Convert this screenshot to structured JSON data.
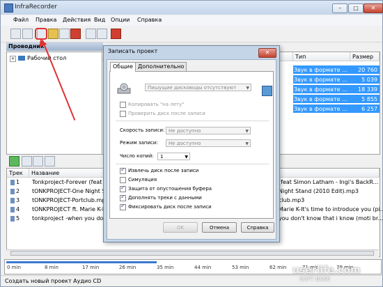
{
  "window": {
    "title": "InfraRecorder",
    "minimize": "–",
    "maximize": "□",
    "close": "✕"
  },
  "menu": [
    "Файл",
    "Правка",
    "Действия",
    "Вид",
    "Опции",
    "Справка"
  ],
  "explorer": {
    "title": "Проводник",
    "tree_item": "Рабочий стол"
  },
  "filelist": {
    "headers": {
      "type": "Тип",
      "size": "Размер"
    },
    "rows": [
      {
        "type": "Звук в формате ...",
        "size": "20 760"
      },
      {
        "type": "Звук в формате ...",
        "size": "5 039"
      },
      {
        "type": "Звук в формате ...",
        "size": "18 339"
      },
      {
        "type": "Звук в формате ...",
        "size": "5 855"
      },
      {
        "type": "Звук в формате ...",
        "size": "6 257"
      }
    ]
  },
  "tracks": {
    "headers": {
      "track": "Трек",
      "name": "Название"
    },
    "rows": [
      {
        "num": "1",
        "name": "Tonkproject-Forever (feat Sin",
        "right": "(feat Simon Latham - Ingi's BackR..."
      },
      {
        "num": "2",
        "name": "tONKPROJECT-One Night Sta",
        "right": "Night Stand (2010 Edit).mp3"
      },
      {
        "num": "3",
        "name": "tONKPROJECT-Portclub.mp3",
        "right": "club.mp3"
      },
      {
        "num": "4",
        "name": "tONKPROJECT ft. Marie K-It'",
        "right": "Marie K-It's time to introduce you (pi..."
      },
      {
        "num": "5",
        "name": "tonkproject -when you don't",
        "right": "you don't know that i know (moti br..."
      }
    ]
  },
  "timeline": [
    "0 min",
    "8 min",
    "17 min",
    "26 min",
    "35 min",
    "44 min",
    "53 min",
    "62 min",
    "71 min",
    "79 min"
  ],
  "status": "Создать новый проект Аудио CD",
  "watermark": {
    "main": "userlife.com",
    "sub": "SOFT  BASE"
  },
  "dialog": {
    "title": "Записать проект",
    "close": "✕",
    "tabs": [
      "Общие",
      "Дополнительно"
    ],
    "recorder": "Пишущие дисководы отсутствуют",
    "copy_fly": "Копировать \"на лету\"",
    "verify": "Проверить диск после записи",
    "speed_label": "Скорость записи:",
    "speed_value": "Не доступно",
    "mode_label": "Режим записи:",
    "mode_value": "Не доступно",
    "copies_label": "Число копий:",
    "copies_value": "1",
    "eject": "Извлечь диск после записи",
    "simulate": "Симуляция",
    "underrun": "Защита от опустошения буфера",
    "pad": "Дополнять треки с данными",
    "fixate": "Фиксировать диск после записи",
    "ok": "OK",
    "cancel": "Отмена",
    "help": "Справка"
  }
}
